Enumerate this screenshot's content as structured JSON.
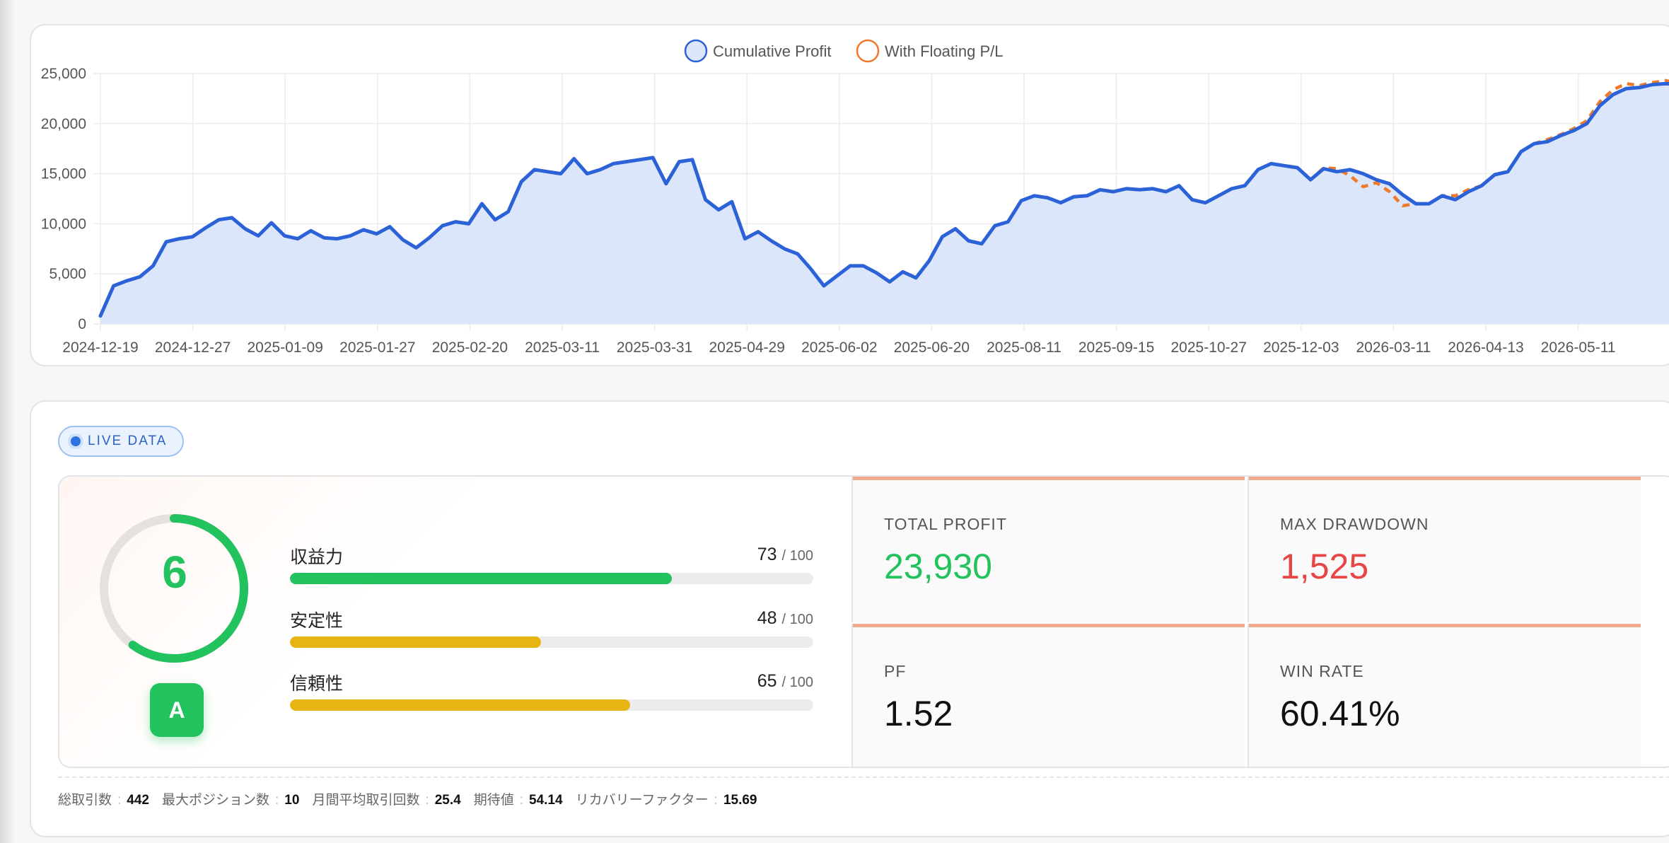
{
  "chart": {
    "legend": [
      {
        "label": "Cumulative Profit",
        "color": "#2c62d8"
      },
      {
        "label": "With Floating P/L",
        "color": "#f07a2a"
      }
    ]
  },
  "chart_data": {
    "type": "line",
    "y_ticks": [
      "0",
      "5,000",
      "10,000",
      "15,000",
      "20,000",
      "25,000"
    ],
    "ylim": [
      0,
      25000
    ],
    "x_ticks": [
      "2024-12-19",
      "2024-12-27",
      "2025-01-09",
      "2025-01-27",
      "2025-02-20",
      "2025-03-11",
      "2025-03-31",
      "2025-04-29",
      "2025-06-02",
      "2025-06-20",
      "2025-08-11",
      "2025-09-15",
      "2025-10-27",
      "2025-12-03",
      "2026-03-11",
      "2026-04-13",
      "2026-05-11"
    ],
    "series": [
      {
        "name": "Cumulative Profit",
        "color": "#2c62d8",
        "fill": true,
        "values": [
          800,
          3800,
          4300,
          4700,
          5800,
          8200,
          8500,
          8700,
          9600,
          10400,
          10600,
          9500,
          8800,
          10100,
          8800,
          8500,
          9300,
          8600,
          8500,
          8800,
          9400,
          9000,
          9700,
          8400,
          7600,
          8600,
          9800,
          10200,
          10000,
          12000,
          10400,
          11200,
          14200,
          15400,
          15200,
          15000,
          16500,
          15000,
          15400,
          16000,
          16200,
          16400,
          16600,
          14000,
          16200,
          16400,
          12400,
          11400,
          12200,
          8500,
          9200,
          8300,
          7500,
          7000,
          5500,
          3800,
          4800,
          5800,
          5800,
          5100,
          4200,
          5200,
          4600,
          6300,
          8700,
          9500,
          8300,
          8000,
          9800,
          10200,
          12300,
          12800,
          12600,
          12100,
          12700,
          12800,
          13400,
          13200,
          13500,
          13400,
          13500,
          13200,
          13800,
          12400,
          12100,
          12800,
          13500,
          13800,
          15400,
          16000,
          15800,
          15600,
          14400,
          15500,
          15200,
          15400,
          15000,
          14400,
          14000,
          12900,
          12000,
          12000,
          12800,
          12400,
          13200,
          13800,
          14900,
          15200,
          17200,
          18000,
          18200,
          18800,
          19300,
          20000,
          21800,
          22900,
          23500,
          23600,
          23900,
          24000,
          23930
        ]
      },
      {
        "name": "With Floating P/L",
        "color": "#f07a2a",
        "dashed": true,
        "values": [
          800,
          3800,
          4300,
          4700,
          5800,
          8200,
          8500,
          8700,
          9600,
          10400,
          10600,
          9500,
          8800,
          10100,
          8800,
          8500,
          9300,
          8600,
          8500,
          8800,
          9400,
          9000,
          9700,
          8400,
          7600,
          8600,
          9800,
          10200,
          10000,
          12000,
          10400,
          11200,
          14200,
          15400,
          15200,
          15000,
          16500,
          15000,
          15400,
          16000,
          16200,
          16400,
          16600,
          14000,
          16200,
          16400,
          12400,
          11400,
          12200,
          8500,
          9200,
          8300,
          7500,
          7000,
          5500,
          3800,
          4800,
          5800,
          5800,
          5100,
          4200,
          5200,
          4600,
          6300,
          8700,
          9500,
          8300,
          8000,
          9800,
          10200,
          12300,
          12800,
          12600,
          12100,
          12700,
          12800,
          13400,
          13200,
          13500,
          13400,
          13500,
          13200,
          13800,
          12400,
          12100,
          12800,
          13500,
          13800,
          15400,
          16000,
          15800,
          15600,
          14400,
          15600,
          15500,
          14800,
          13700,
          14100,
          13200,
          11800,
          12000,
          12000,
          12800,
          12800,
          13400,
          13800,
          14900,
          15200,
          17200,
          18000,
          18400,
          18900,
          19500,
          20300,
          22200,
          23400,
          24000,
          23800,
          24100,
          24300,
          24000
        ]
      }
    ]
  },
  "badge": {
    "live": "LIVE DATA"
  },
  "score": {
    "value": "6",
    "ratio": 0.6,
    "grade": "A",
    "bars": [
      {
        "label": "収益力",
        "value": "73",
        "max": "/ 100",
        "ratio": 0.73,
        "color": "#22c25e"
      },
      {
        "label": "安定性",
        "value": "48",
        "max": "/ 100",
        "ratio": 0.48,
        "color": "#e8b414"
      },
      {
        "label": "信頼性",
        "value": "65",
        "max": "/ 100",
        "ratio": 0.65,
        "color": "#e8b414"
      }
    ]
  },
  "stats": {
    "total_profit": {
      "label": "TOTAL PROFIT",
      "value": "23,930",
      "color": "#22c25e"
    },
    "max_drawdown": {
      "label": "MAX DRAWDOWN",
      "value": "1,525",
      "color": "#e84545"
    },
    "pf": {
      "label": "PF",
      "value": "1.52",
      "color": "#111111"
    },
    "win_rate": {
      "label": "WIN RATE",
      "value": "60.41%",
      "color": "#111111"
    }
  },
  "footer": {
    "total_trades_label": "総取引数",
    "total_trades": "442",
    "max_positions_label": "最大ポジション数",
    "max_positions": "10",
    "monthly_avg_label": "月間平均取引回数",
    "monthly_avg": "25.4",
    "expectancy_label": "期待値",
    "expectancy": "54.14",
    "recovery_label": "リカバリーファクター",
    "recovery": "15.69",
    "separator": ":"
  }
}
